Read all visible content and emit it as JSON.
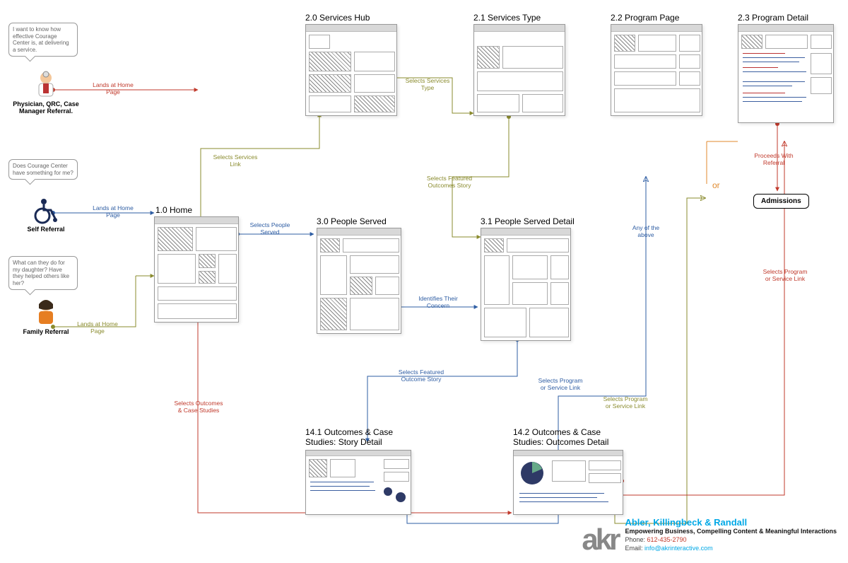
{
  "personas": {
    "physician": {
      "caption": "Physician, QRC, Case Manager Referral.",
      "bubble": "I want to know how effective Courage Center is, at delivering a service."
    },
    "self": {
      "caption": "Self Referral",
      "bubble": "Does Courage Center have something for me?"
    },
    "family": {
      "caption": "Family Referral",
      "bubble": "What can they do for my daughter? Have they helped others like her?"
    }
  },
  "nodes": {
    "home": "1.0  Home",
    "services_hub": "2.0  Services Hub",
    "services_type": "2.1  Services Type",
    "program_page": "2.2  Program Page",
    "program_detail": "2.3  Program Detail",
    "people_served": "3.0  People Served",
    "people_served_detail": "3.1  People Served Detail",
    "outcomes_story": "14.1  Outcomes & Case Studies: Story Detail",
    "outcomes_detail": "14.2  Outcomes & Case Studies: Outcomes Detail",
    "admissions": "Admissions"
  },
  "edges": {
    "lands_home_1": "Lands at Home Page",
    "lands_home_2": "Lands at Home Page",
    "lands_home_3": "Lands at Home Page",
    "selects_services_link": "Selects Services Link",
    "selects_services_type": "Selects Services Type",
    "selects_people_served": "Selects People Served",
    "identifies_concern": "Identifies Their Concern",
    "featured_outcome_1": "Selects Featured Outcomes Story",
    "featured_outcome_2": "Selects Featured Outcome Story",
    "selects_outcomes_cs": "Selects Outcomes & Case Studies",
    "program_link_blue": "Selects Program or Service Link",
    "program_link_olive": "Selects Program or Service Link",
    "program_link_red": "Selects Program or Service Link",
    "any_above": "Any of the above",
    "or": "or",
    "proceeds_referral": "Proceeds With Referral"
  },
  "footer": {
    "brand": "Abler, Killingbeck & Randall",
    "tag": "Empowering Business, Compelling Content & Meaningful Interactions",
    "phone_label": "Phone:",
    "phone": "612-435-2790",
    "email_label": "Email:",
    "email": "info@akrinteractive.com",
    "logo": "akr"
  }
}
